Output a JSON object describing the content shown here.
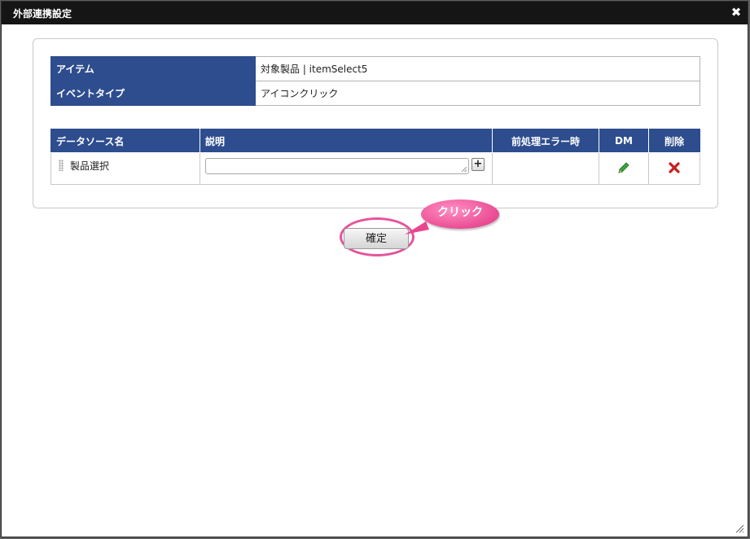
{
  "dialog": {
    "title": "外部連携設定",
    "close_icon": "close-icon"
  },
  "info": {
    "rows": [
      {
        "label": "アイテム",
        "value": "対象製品 | itemSelect5"
      },
      {
        "label": "イベントタイプ",
        "value": "アイコンクリック"
      }
    ]
  },
  "datasource": {
    "headers": [
      "データソース名",
      "説明",
      "前処理エラー時",
      "DM",
      "削除"
    ],
    "rows": [
      {
        "name": "製品選択",
        "description": "",
        "preprocess_error": ""
      }
    ]
  },
  "buttons": {
    "confirm": "確定"
  },
  "annotation": {
    "callout": "クリック",
    "color": "#e5549a"
  },
  "colors": {
    "header_bg": "#2e4d8e",
    "titlebar_bg": "#151515"
  }
}
